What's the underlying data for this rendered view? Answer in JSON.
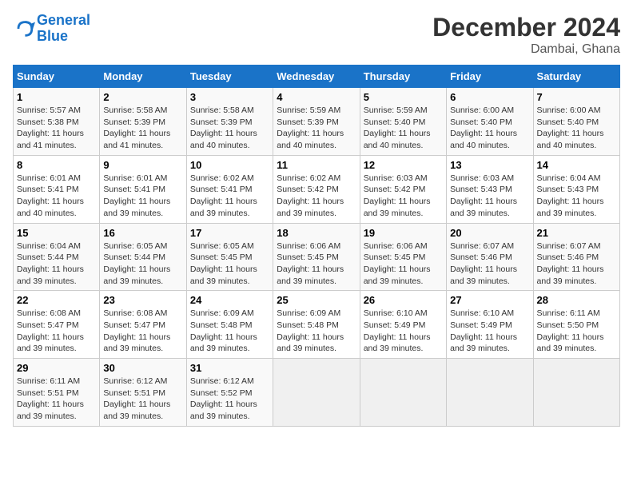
{
  "logo": {
    "line1": "General",
    "line2": "Blue"
  },
  "title": "December 2024",
  "subtitle": "Dambai, Ghana",
  "days_of_week": [
    "Sunday",
    "Monday",
    "Tuesday",
    "Wednesday",
    "Thursday",
    "Friday",
    "Saturday"
  ],
  "weeks": [
    [
      {
        "day": 1,
        "info": "Sunrise: 5:57 AM\nSunset: 5:38 PM\nDaylight: 11 hours and 41 minutes."
      },
      {
        "day": 2,
        "info": "Sunrise: 5:58 AM\nSunset: 5:39 PM\nDaylight: 11 hours and 41 minutes."
      },
      {
        "day": 3,
        "info": "Sunrise: 5:58 AM\nSunset: 5:39 PM\nDaylight: 11 hours and 40 minutes."
      },
      {
        "day": 4,
        "info": "Sunrise: 5:59 AM\nSunset: 5:39 PM\nDaylight: 11 hours and 40 minutes."
      },
      {
        "day": 5,
        "info": "Sunrise: 5:59 AM\nSunset: 5:40 PM\nDaylight: 11 hours and 40 minutes."
      },
      {
        "day": 6,
        "info": "Sunrise: 6:00 AM\nSunset: 5:40 PM\nDaylight: 11 hours and 40 minutes."
      },
      {
        "day": 7,
        "info": "Sunrise: 6:00 AM\nSunset: 5:40 PM\nDaylight: 11 hours and 40 minutes."
      }
    ],
    [
      {
        "day": 8,
        "info": "Sunrise: 6:01 AM\nSunset: 5:41 PM\nDaylight: 11 hours and 40 minutes."
      },
      {
        "day": 9,
        "info": "Sunrise: 6:01 AM\nSunset: 5:41 PM\nDaylight: 11 hours and 39 minutes."
      },
      {
        "day": 10,
        "info": "Sunrise: 6:02 AM\nSunset: 5:41 PM\nDaylight: 11 hours and 39 minutes."
      },
      {
        "day": 11,
        "info": "Sunrise: 6:02 AM\nSunset: 5:42 PM\nDaylight: 11 hours and 39 minutes."
      },
      {
        "day": 12,
        "info": "Sunrise: 6:03 AM\nSunset: 5:42 PM\nDaylight: 11 hours and 39 minutes."
      },
      {
        "day": 13,
        "info": "Sunrise: 6:03 AM\nSunset: 5:43 PM\nDaylight: 11 hours and 39 minutes."
      },
      {
        "day": 14,
        "info": "Sunrise: 6:04 AM\nSunset: 5:43 PM\nDaylight: 11 hours and 39 minutes."
      }
    ],
    [
      {
        "day": 15,
        "info": "Sunrise: 6:04 AM\nSunset: 5:44 PM\nDaylight: 11 hours and 39 minutes."
      },
      {
        "day": 16,
        "info": "Sunrise: 6:05 AM\nSunset: 5:44 PM\nDaylight: 11 hours and 39 minutes."
      },
      {
        "day": 17,
        "info": "Sunrise: 6:05 AM\nSunset: 5:45 PM\nDaylight: 11 hours and 39 minutes."
      },
      {
        "day": 18,
        "info": "Sunrise: 6:06 AM\nSunset: 5:45 PM\nDaylight: 11 hours and 39 minutes."
      },
      {
        "day": 19,
        "info": "Sunrise: 6:06 AM\nSunset: 5:45 PM\nDaylight: 11 hours and 39 minutes."
      },
      {
        "day": 20,
        "info": "Sunrise: 6:07 AM\nSunset: 5:46 PM\nDaylight: 11 hours and 39 minutes."
      },
      {
        "day": 21,
        "info": "Sunrise: 6:07 AM\nSunset: 5:46 PM\nDaylight: 11 hours and 39 minutes."
      }
    ],
    [
      {
        "day": 22,
        "info": "Sunrise: 6:08 AM\nSunset: 5:47 PM\nDaylight: 11 hours and 39 minutes."
      },
      {
        "day": 23,
        "info": "Sunrise: 6:08 AM\nSunset: 5:47 PM\nDaylight: 11 hours and 39 minutes."
      },
      {
        "day": 24,
        "info": "Sunrise: 6:09 AM\nSunset: 5:48 PM\nDaylight: 11 hours and 39 minutes."
      },
      {
        "day": 25,
        "info": "Sunrise: 6:09 AM\nSunset: 5:48 PM\nDaylight: 11 hours and 39 minutes."
      },
      {
        "day": 26,
        "info": "Sunrise: 6:10 AM\nSunset: 5:49 PM\nDaylight: 11 hours and 39 minutes."
      },
      {
        "day": 27,
        "info": "Sunrise: 6:10 AM\nSunset: 5:49 PM\nDaylight: 11 hours and 39 minutes."
      },
      {
        "day": 28,
        "info": "Sunrise: 6:11 AM\nSunset: 5:50 PM\nDaylight: 11 hours and 39 minutes."
      }
    ],
    [
      {
        "day": 29,
        "info": "Sunrise: 6:11 AM\nSunset: 5:51 PM\nDaylight: 11 hours and 39 minutes."
      },
      {
        "day": 30,
        "info": "Sunrise: 6:12 AM\nSunset: 5:51 PM\nDaylight: 11 hours and 39 minutes."
      },
      {
        "day": 31,
        "info": "Sunrise: 6:12 AM\nSunset: 5:52 PM\nDaylight: 11 hours and 39 minutes."
      },
      null,
      null,
      null,
      null
    ]
  ]
}
